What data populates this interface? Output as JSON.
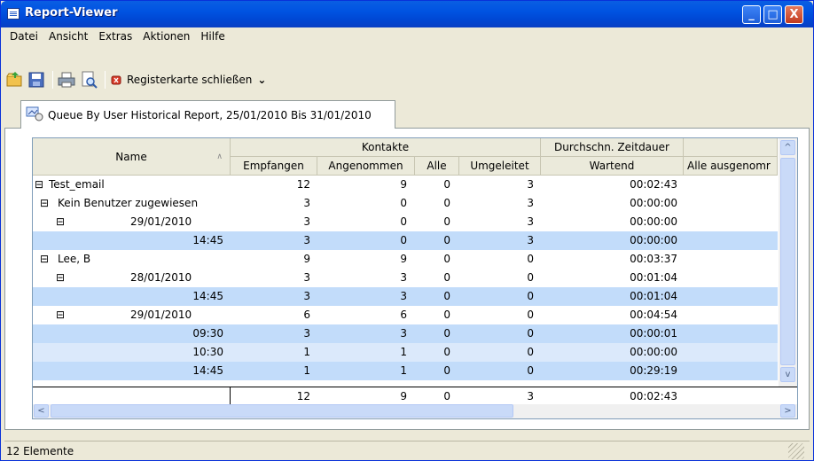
{
  "window": {
    "title": "Report-Viewer",
    "buttons": [
      "_",
      "□",
      "X"
    ]
  },
  "menu": [
    "Datei",
    "Ansicht",
    "Extras",
    "Aktionen",
    "Hilfe"
  ],
  "toolbar": {
    "items": [
      "open-icon",
      "save-icon",
      "print-icon",
      "print-preview-icon",
      "close-tab-icon"
    ],
    "close_tab_label": "Registerkarte schließen",
    "dropdown": "⌄"
  },
  "tab": {
    "label": "Queue By User Historical Report, 25/01/2010 Bis 31/01/2010"
  },
  "grid": {
    "group_headers": {
      "kontakte": "Kontakte",
      "zeitdauer": "Durchschn. Zeitdauer"
    },
    "columns": {
      "name": "Name",
      "sort_glyph": "∧",
      "empfangen": "Empfangen",
      "angenommen": "Angenommen",
      "alle": "Alle",
      "umgeleitet": "Umgeleitet",
      "wartend": "Wartend",
      "alle_ausgenommen": "Alle ausgenomr"
    },
    "rows": [
      {
        "name": "Test_email",
        "empfangen": "12",
        "angenommen": "9",
        "alle": "0",
        "umgeleitet": "3",
        "wartend": "00:02:43"
      },
      {
        "name": "Kein Benutzer zugewiesen",
        "empfangen": "3",
        "angenommen": "0",
        "alle": "0",
        "umgeleitet": "3",
        "wartend": "00:00:00"
      },
      {
        "name": "29/01/2010",
        "empfangen": "3",
        "angenommen": "0",
        "alle": "0",
        "umgeleitet": "3",
        "wartend": "00:00:00"
      },
      {
        "name": "14:45",
        "empfangen": "3",
        "angenommen": "0",
        "alle": "0",
        "umgeleitet": "3",
        "wartend": "00:00:00"
      },
      {
        "name": "Lee, B",
        "empfangen": "9",
        "angenommen": "9",
        "alle": "0",
        "umgeleitet": "0",
        "wartend": "00:03:37"
      },
      {
        "name": "28/01/2010",
        "empfangen": "3",
        "angenommen": "3",
        "alle": "0",
        "umgeleitet": "0",
        "wartend": "00:01:04"
      },
      {
        "name": "14:45",
        "empfangen": "3",
        "angenommen": "3",
        "alle": "0",
        "umgeleitet": "0",
        "wartend": "00:01:04"
      },
      {
        "name": "29/01/2010",
        "empfangen": "6",
        "angenommen": "6",
        "alle": "0",
        "umgeleitet": "0",
        "wartend": "00:04:54"
      },
      {
        "name": "09:30",
        "empfangen": "3",
        "angenommen": "3",
        "alle": "0",
        "umgeleitet": "0",
        "wartend": "00:00:01"
      },
      {
        "name": "10:30",
        "empfangen": "1",
        "angenommen": "1",
        "alle": "0",
        "umgeleitet": "0",
        "wartend": "00:00:00"
      },
      {
        "name": "14:45",
        "empfangen": "1",
        "angenommen": "1",
        "alle": "0",
        "umgeleitet": "0",
        "wartend": "00:29:19"
      }
    ],
    "totals": {
      "empfangen": "12",
      "angenommen": "9",
      "alle": "0",
      "umgeleitet": "3",
      "wartend": "00:02:43"
    },
    "expand_glyph": "⊟"
  },
  "scroll": {
    "up": "^",
    "down": "v",
    "left": "<",
    "right": ">"
  },
  "status": {
    "text": "12 Elemente"
  }
}
